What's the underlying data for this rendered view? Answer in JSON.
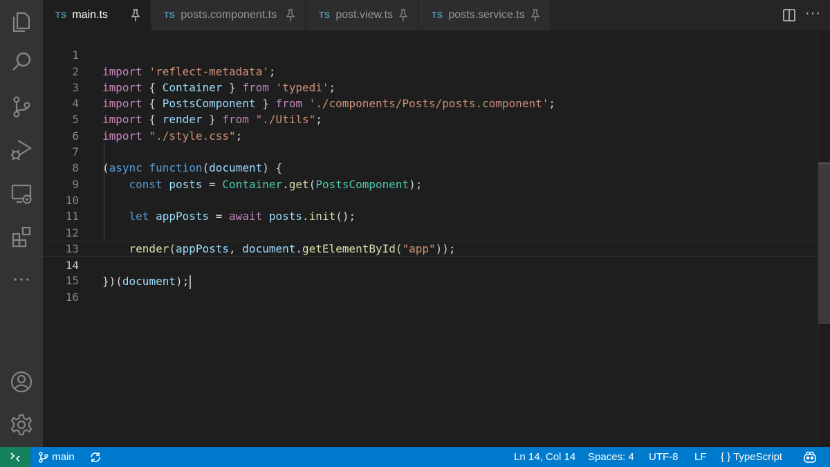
{
  "activity_bar": {
    "items": [
      {
        "icon": "explorer-icon"
      },
      {
        "icon": "search-icon"
      },
      {
        "icon": "source-control-icon"
      },
      {
        "icon": "run-debug-icon"
      },
      {
        "icon": "remote-explorer-icon"
      },
      {
        "icon": "extensions-icon"
      },
      {
        "icon": "more-icon"
      }
    ],
    "bottom": [
      {
        "icon": "account-icon"
      },
      {
        "icon": "settings-gear-icon"
      }
    ]
  },
  "tabs": [
    {
      "lang": "TS",
      "label": "main.ts",
      "active": true
    },
    {
      "lang": "TS",
      "label": "posts.component.ts",
      "active": false
    },
    {
      "lang": "TS",
      "label": "post.view.ts",
      "active": false
    },
    {
      "lang": "TS",
      "label": "posts.service.ts",
      "active": false
    }
  ],
  "editor": {
    "line_numbers": [
      "1",
      "2",
      "3",
      "4",
      "5",
      "6",
      "7",
      "8",
      "9",
      "10",
      "11",
      "12",
      "13",
      "14",
      "15",
      "16"
    ],
    "current_line": 14
  },
  "code": {
    "l1": {
      "import": "import",
      "str": "'reflect-metadata'",
      "end": ";"
    },
    "l2": {
      "import": "import",
      "open": " { ",
      "name": "Container",
      "close": " } ",
      "from": "from",
      "str": "'typedi'",
      "end": ";"
    },
    "l3": {
      "import": "import",
      "open": " { ",
      "name": "PostsComponent",
      "close": " } ",
      "from": "from",
      "str": "'./components/Posts/posts.component'",
      "end": ";"
    },
    "l4": {
      "import": "import",
      "open": " { ",
      "name": "render",
      "close": " } ",
      "from": "from",
      "str": "\"./Utils\"",
      "end": ";"
    },
    "l5": {
      "import": "import",
      "str": "\"./style.css\"",
      "end": ";"
    },
    "l7": {
      "paren": "(",
      "async": "async",
      "function": "function",
      "open": "(",
      "param": "document",
      "close": ") {"
    },
    "l8": {
      "const": "const",
      "var": "posts",
      "eq": " = ",
      "cls": "Container",
      "dot": ".",
      "fn": "get",
      "open": "(",
      "arg": "PostsComponent",
      "close": ");"
    },
    "l10": {
      "let": "let",
      "var": "appPosts",
      "eq": " = ",
      "await": "await",
      "obj": "posts",
      "dot": ".",
      "fn": "init",
      "close": "();"
    },
    "l12": {
      "fn": "render",
      "open": "(",
      "arg1": "appPosts",
      "comma": ", ",
      "obj": "document",
      "dot": ".",
      "fn2": "getElementById",
      "open2": "(",
      "str": "\"app\"",
      "close": "));"
    },
    "l14": {
      "close": "})(",
      "arg": "document",
      "end": ");"
    }
  },
  "statusbar": {
    "branch": "main",
    "position": "Ln 14, Col 14",
    "spaces": "Spaces: 4",
    "encoding": "UTF-8",
    "eol": "LF",
    "language_icon": "{ }",
    "language": "TypeScript"
  }
}
